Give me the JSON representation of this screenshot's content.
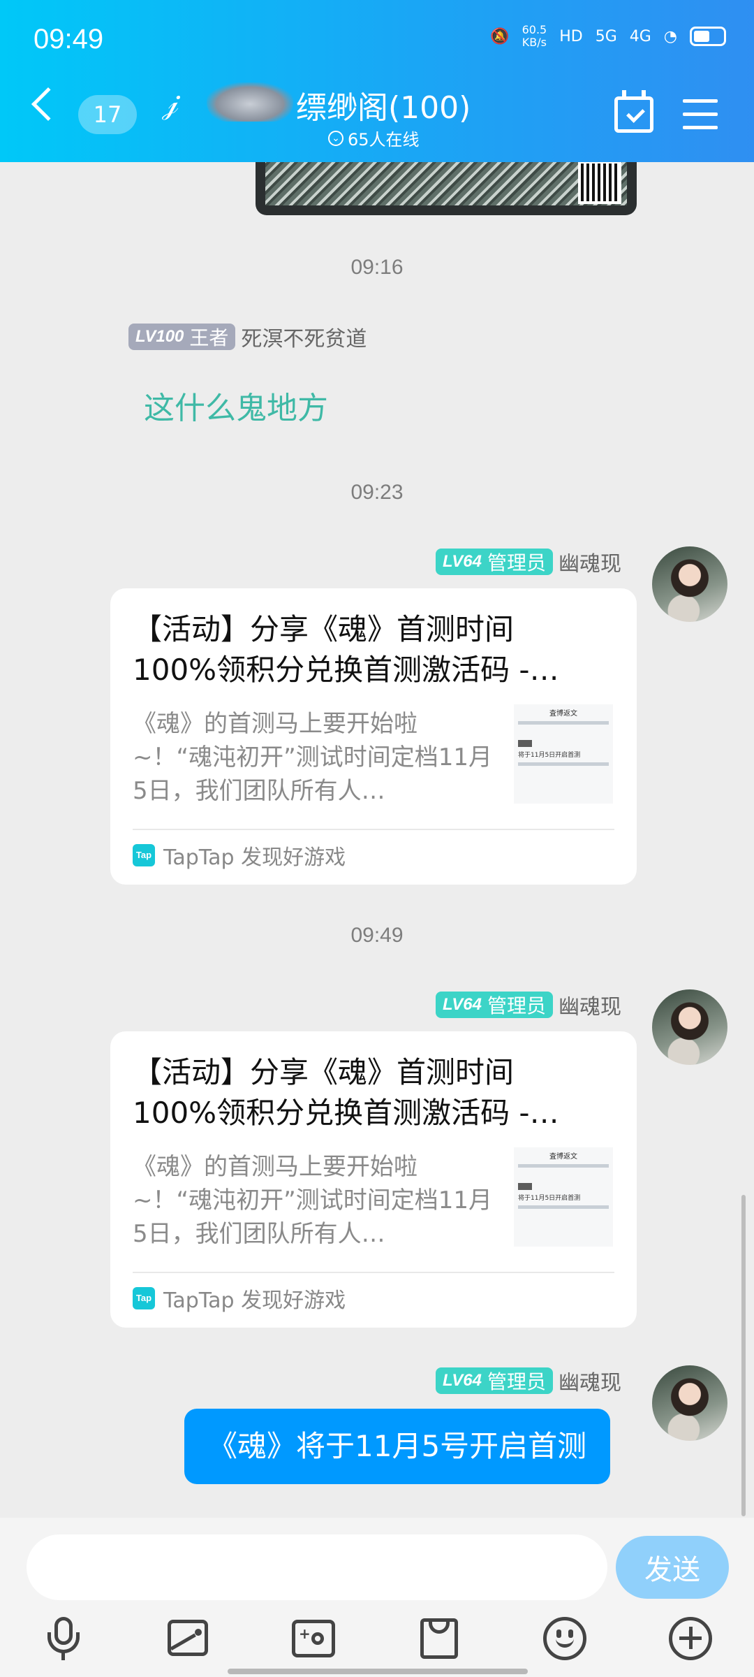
{
  "status_bar": {
    "time": "09:49",
    "speed_value": "60.5",
    "speed_unit": "KB/s",
    "hd": "HD",
    "network1": "5G",
    "network2": "4G",
    "icons": [
      "wechat-icon",
      "mute-icon",
      "signal-icon",
      "wifi-icon",
      "battery-icon"
    ]
  },
  "header": {
    "unread_count": "17",
    "group_name": "缥缈阁(100)",
    "online_text": "65人在线",
    "icons": [
      "back-icon",
      "ear-icon",
      "calendar-check-icon",
      "menu-icon"
    ],
    "accent": "#12b4f5"
  },
  "chat": {
    "messages": [
      {
        "time": "09:16",
        "level": "LV100",
        "role": "王者",
        "nick": "死溟不死贫道",
        "text": "这什么鬼地方"
      },
      {
        "time": "09:23",
        "level": "LV64",
        "role": "管理员",
        "nick": "幽魂现",
        "card": {
          "title_line1": "【活动】分享《魂》首测时间",
          "title_line2": "100%领积分兑换首测激活码 -…",
          "desc": "《魂》的首测马上要开始啦~！“魂沌初开”测试时间定档11月5日，我们团队所有人…",
          "source": "TapTap 发现好游戏",
          "thumb_title": "査博返文",
          "thumb_text": "将于11月5日开启首测"
        }
      },
      {
        "time": "09:49",
        "level": "LV64",
        "role": "管理员",
        "nick": "幽魂现",
        "card": {
          "title_line1": "【活动】分享《魂》首测时间",
          "title_line2": "100%领积分兑换首测激活码 -…",
          "desc": "《魂》的首测马上要开始啦~！“魂沌初开”测试时间定档11月5日，我们团队所有人…",
          "source": "TapTap 发现好游戏",
          "thumb_title": "査博返文",
          "thumb_text": "将于11月5日开启首测"
        }
      },
      {
        "level": "LV64",
        "role": "管理员",
        "nick": "幽魂现",
        "text": "《魂》将于11月5号开启首测"
      }
    ]
  },
  "input": {
    "placeholder": "",
    "send_label": "发送"
  },
  "toolbar": {
    "icons": [
      "microphone-icon",
      "image-icon",
      "camera-icon",
      "file-icon",
      "emoji-icon",
      "plus-icon"
    ]
  }
}
